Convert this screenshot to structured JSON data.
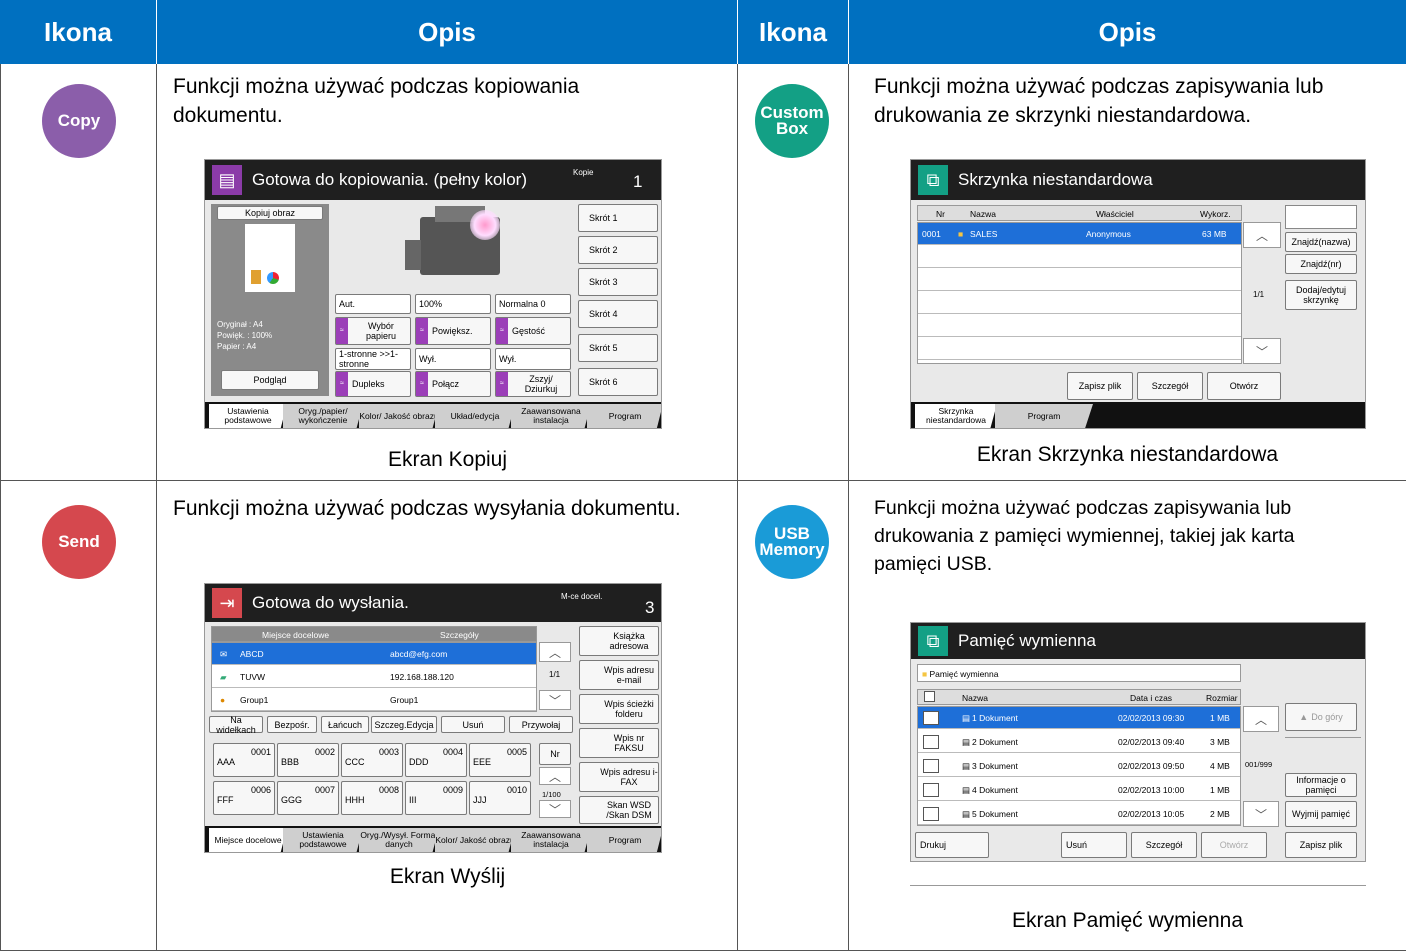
{
  "headers": [
    "Ikona",
    "Opis",
    "Ikona",
    "Opis"
  ],
  "colors": {
    "header": "#0070c0",
    "copy": "#8b5eaa",
    "custom_box": "#13a085",
    "send": "#d5484e",
    "usb": "#1a9bd7"
  },
  "cells": {
    "copy": {
      "badge": "Copy",
      "desc": "Funkcji można używać podczas kopiowania dokumentu.",
      "caption": "Ekran Kopiuj"
    },
    "custom_box": {
      "badge_l1": "Custom",
      "badge_l2": "Box",
      "desc": "Funkcji można używać podczas zapisywania lub drukowania ze skrzynki niestandardowa.",
      "caption": "Ekran Skrzynka niestandardowa"
    },
    "send": {
      "badge": "Send",
      "desc": "Funkcji można używać podczas wysyłania dokumentu.",
      "caption": "Ekran Wyślij"
    },
    "usb": {
      "badge_l1": "USB",
      "badge_l2": "Memory",
      "desc": "Funkcji można używać podczas zapisywania lub drukowania z pamięci wymiennej, takiej jak karta pamięci USB.",
      "caption": "Ekran Pamięć wymienna"
    }
  },
  "copy_screen": {
    "title": "Gotowa do kopiowania. (pełny kolor)",
    "count_label": "Kopie",
    "count": "1",
    "preview_title": "Kopiuj obraz",
    "info": [
      "Oryginał  : A4",
      "Powięk.  : 100%",
      "Papier    : A4"
    ],
    "preview_btn": "Podgląd",
    "shortcuts": [
      "Skrót 1",
      "Skrót 2",
      "Skrót 3",
      "Skrót 4",
      "Skrót 5",
      "Skrót 6"
    ],
    "row1_vals": [
      "Aut.",
      "100%",
      "Normalna 0"
    ],
    "row1_btns": [
      "Wybór papieru",
      "Powiększ.",
      "Gęstość"
    ],
    "row2_vals": [
      "1-stronne >>1-stronne",
      "Wył.",
      "Wył."
    ],
    "row2_btns": [
      "Dupleks",
      "Połącz",
      "Zszyj/ Dziurkuj"
    ],
    "tabs": [
      "Ustawienia podstawowe",
      "Oryg./papier/ wykończenie",
      "Kolor/ Jakość obrazu",
      "Układ/edycja",
      "Zaawansowana instalacja",
      "Program"
    ]
  },
  "box_screen": {
    "title": "Skrzynka niestandardowa",
    "cols": [
      "Nr",
      "Nazwa",
      "Właściciel",
      "Wykorz."
    ],
    "row": {
      "nr": "0001",
      "name": "SALES",
      "owner": "Anonymous",
      "used": "63 MB"
    },
    "page": "1/1",
    "side_btns": [
      "Znajdź(nazwa)",
      "Znajdź(nr)",
      "Dodaj/edytuj skrzynkę"
    ],
    "bottom_btns": [
      "Zapisz plik",
      "Szczegół",
      "Otwórz"
    ],
    "tabs": [
      "Skrzynka niestandardowa",
      "Program"
    ]
  },
  "send_screen": {
    "title": "Gotowa do wysłania.",
    "count_label": "M-ce docel.",
    "count": "3",
    "cols": [
      "Miejsce docelowe",
      "Szczegóły"
    ],
    "rows": [
      {
        "name": "ABCD",
        "detail": "abcd@efg.com"
      },
      {
        "name": "TUVW",
        "detail": "192.168.188.120"
      },
      {
        "name": "Group1",
        "detail": "Group1"
      }
    ],
    "page": "1/1",
    "action_btns": [
      "Na widełkach",
      "Bezpośr.",
      "Łańcuch",
      "Szczeg.Edycja",
      "Usuń",
      "Przywołaj"
    ],
    "addr": [
      {
        "num": "0001",
        "name": "AAA"
      },
      {
        "num": "0002",
        "name": "BBB"
      },
      {
        "num": "0003",
        "name": "CCC"
      },
      {
        "num": "0004",
        "name": "DDD"
      },
      {
        "num": "0005",
        "name": "EEE"
      },
      {
        "num": "0006",
        "name": "FFF"
      },
      {
        "num": "0007",
        "name": "GGG"
      },
      {
        "num": "0008",
        "name": "HHH"
      },
      {
        "num": "0009",
        "name": "III"
      },
      {
        "num": "0010",
        "name": "JJJ"
      }
    ],
    "nr_btn": "Nr",
    "addr_page": "1/100",
    "side_btns": [
      "Książka adresowa",
      "Wpis adresu e-mail",
      "Wpis ścieżki folderu",
      "Wpis nr FAKSU",
      "Wpis adresu i-FAX",
      "Skan WSD /Skan DSM"
    ],
    "tabs": [
      "Miejsce docelowe",
      "Ustawienia podstawowe",
      "Oryg./Wysył. Format danych",
      "Kolor/ Jakość obrazu",
      "Zaawansowana instalacja",
      "Program"
    ]
  },
  "usb_screen": {
    "title": "Pamięć wymienna",
    "path": "Pamięć wymienna",
    "cols": [
      "Nazwa",
      "Data i czas",
      "Rozmiar"
    ],
    "rows": [
      {
        "name": "1 Dokument",
        "date": "02/02/2013 09:30",
        "size": "1 MB"
      },
      {
        "name": "2 Dokument",
        "date": "02/02/2013 09:40",
        "size": "3 MB"
      },
      {
        "name": "3 Dokument",
        "date": "02/02/2013 09:50",
        "size": "4 MB"
      },
      {
        "name": "4 Dokument",
        "date": "02/02/2013 10:00",
        "size": "1 MB"
      },
      {
        "name": "5 Dokument",
        "date": "02/02/2013 10:05",
        "size": "2 MB"
      }
    ],
    "page": "001/999",
    "up_btn": "Do góry",
    "side_btns": [
      "Informacje o pamięci",
      "Wyjmij pamięć"
    ],
    "bottom_btns": [
      "Drukuj",
      "Usuń",
      "Szczegół",
      "Otwórz",
      "Zapisz plik"
    ]
  }
}
